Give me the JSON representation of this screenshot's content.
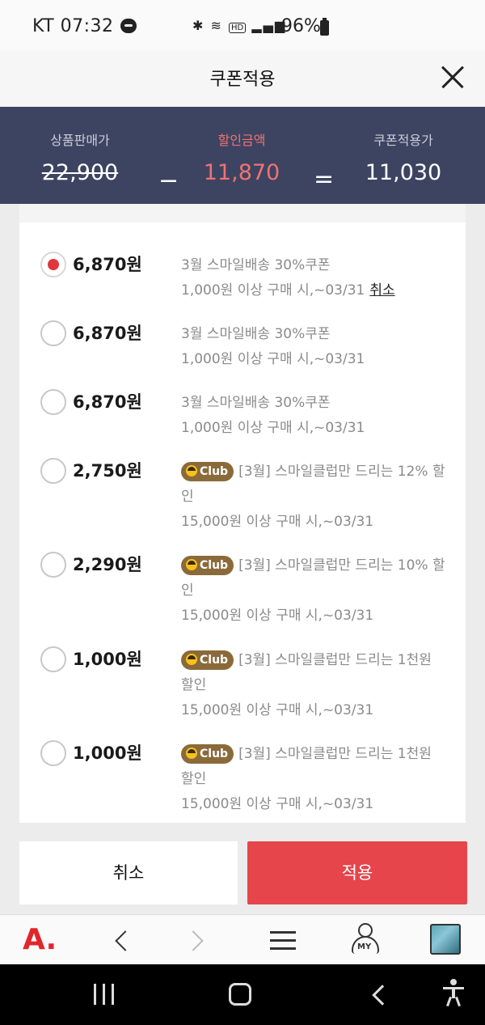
{
  "status_bar": {
    "carrier_time": "KT 07:32",
    "icons": [
      "bluetooth-icon",
      "wifi-icon",
      "hd-icon",
      "signal-icon"
    ],
    "battery": "96%"
  },
  "header": {
    "title": "쿠폰적용"
  },
  "summary": {
    "original_label": "상품판매가",
    "original_value": "22,900",
    "minus": "−",
    "discount_label": "할인금액",
    "discount_value": "11,870",
    "equals": "=",
    "final_label": "쿠폰적용가",
    "final_value": "11,030"
  },
  "coupons": [
    {
      "amount": "6,870",
      "unit": "원",
      "title": "3월 스마일배송 30%쿠폰",
      "condition": "1,000원 이상 구매 시,~03/31",
      "cancel": "취소",
      "selected": true,
      "club": false
    },
    {
      "amount": "6,870",
      "unit": "원",
      "title": "3월 스마일배송 30%쿠폰",
      "condition": "1,000원 이상 구매 시,~03/31",
      "selected": false,
      "club": false
    },
    {
      "amount": "6,870",
      "unit": "원",
      "title": "3월 스마일배송 30%쿠폰",
      "condition": "1,000원 이상 구매 시,~03/31",
      "selected": false,
      "club": false
    },
    {
      "amount": "2,750",
      "unit": "원",
      "badge": "Club",
      "title": "[3월] 스마일클럽만 드리는 12% 할인",
      "condition": "15,000원 이상 구매 시,~03/31",
      "selected": false,
      "club": true
    },
    {
      "amount": "2,290",
      "unit": "원",
      "badge": "Club",
      "title": "[3월] 스마일클럽만 드리는 10% 할인",
      "condition": "15,000원 이상 구매 시,~03/31",
      "selected": false,
      "club": true
    },
    {
      "amount": "1,000",
      "unit": "원",
      "badge": "Club",
      "title": "[3월] 스마일클럽만 드리는 1천원 할인",
      "condition": "15,000원 이상 구매 시,~03/31",
      "selected": false,
      "club": true
    },
    {
      "amount": "1,000",
      "unit": "원",
      "badge": "Club",
      "title": "[3월] 스마일클럽만 드리는 1천원 할인",
      "condition": "15,000원 이상 구매 시,~03/31",
      "selected": false,
      "club": true
    }
  ],
  "actions": {
    "cancel_label": "취소",
    "apply_label": "적용"
  },
  "browser_toolbar": {
    "logo": "A.",
    "my_label": "MY"
  },
  "colors": {
    "accent_red": "#e5454b",
    "summary_bg": "#3d4461",
    "discount_text": "#f07272",
    "club_badge": "#8b6a3a"
  }
}
